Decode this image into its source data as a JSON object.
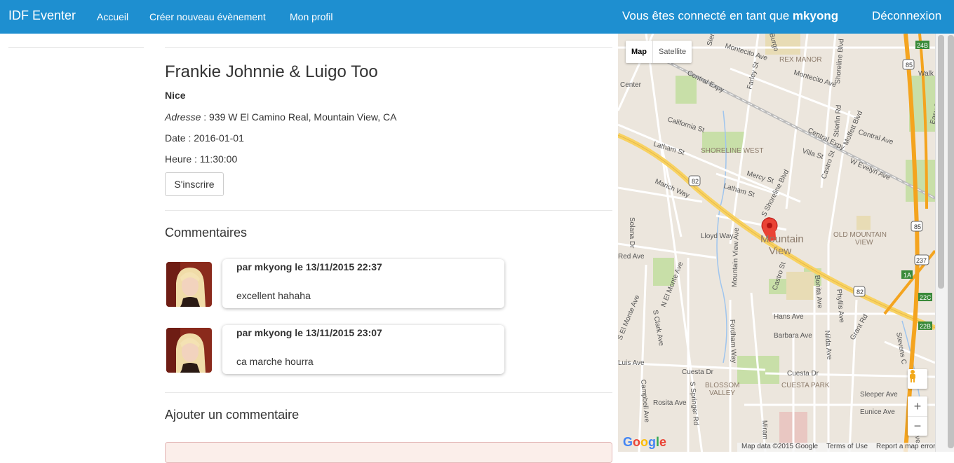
{
  "navbar": {
    "brand": "IDF Eventer",
    "links": [
      "Accueil",
      "Créer nouveau évènement",
      "Mon profil"
    ],
    "connected_text": "Vous êtes connecté en tant que",
    "username": "mkyong",
    "logout": "Déconnexion"
  },
  "event": {
    "title": "Frankie Johnnie & Luigo Too",
    "venue": "Nice",
    "address_label": "Adresse",
    "address": " : 939 W El Camino Real, Mountain View, CA",
    "date": "Date : 2016-01-01",
    "time": "Heure : 11:30:00",
    "register_button": "S'inscrire"
  },
  "comments": {
    "section_title": "Commentaires",
    "items": [
      {
        "author_line": "par mkyong le 13/11/2015 22:37",
        "text": "excellent hahaha"
      },
      {
        "author_line": "par mkyong le 13/11/2015 23:07",
        "text": "ca marche hourra"
      }
    ]
  },
  "add_comment": {
    "section_title": "Ajouter un commentaire"
  },
  "map": {
    "type_map": "Map",
    "type_satellite": "Satellite",
    "zoom_in": "+",
    "zoom_out": "−",
    "attribution": [
      "Map data ©2015 Google",
      "Terms of Use",
      "Report a map error"
    ],
    "google_letters": [
      "G",
      "o",
      "o",
      "g",
      "l",
      "e"
    ],
    "labels": {
      "mountain_view_1": "Mountain",
      "mountain_view_2": "View",
      "rex_manor": "REX MANOR",
      "shoreline_west": "SHORELINE WEST",
      "old_mv_1": "OLD MOUNTAIN",
      "old_mv_2": "VIEW",
      "blossom_1": "BLOSSOM",
      "blossom_2": "VALLEY",
      "cuesta_park": "CUESTA PARK",
      "central_expy": "Central Expy",
      "central_expy2": "Central Expy",
      "california_st": "California St",
      "latham_st": "Latham St",
      "latham_st2": "Latham St",
      "mercy_st": "Mercy St",
      "villa_st": "Villa St",
      "castro_st": "Castro St",
      "castro_st2": "Castro St",
      "evelyn": "W Evelyn Ave",
      "marich": "Marich Way",
      "lloyd": "Lloyd Way",
      "shoreline_blvd": "S Shoreline Blvd",
      "hans": "Hans Ave",
      "barbara": "Barbara Ave",
      "cuesta_dr": "Cuesta Dr",
      "cuesta_dr2": "Cuesta Dr",
      "rosita": "Rosita Ave",
      "sleeper": "Sleeper Ave",
      "eunice": "Eunice Ave",
      "grant": "Grant Rd",
      "montecito": "Montecito Ave",
      "montecito2": "Montecito Ave",
      "farley": "Farley St",
      "sierra": "Sierra Vista",
      "central_ave": "Central Ave",
      "moffett": "Moffett Blvd",
      "stierlin": "Stierlin Rd",
      "shoreline_blvd_n": "Shoreline Blvd",
      "center": "Center",
      "solana": "Solana Dr",
      "red_ave": "Red Ave",
      "el_monte": "N El Monte Ave",
      "s_el_monte": "S El Monte Ave",
      "clark": "S Clark Ave",
      "mv_ave": "Mountain View Ave",
      "fordham": "Fordham Way",
      "springer": "S Springer Rd",
      "campbell": "Campbell Ave",
      "luis": "Luis Ave",
      "bonita": "Bonita Ave",
      "phyllis": "Phyllis Ave",
      "nilda": "Nilda Ave",
      "sun_mor": "Sun Mor Ave",
      "stevens": "Stevens C",
      "easy": "Easy St",
      "walk": "Walk",
      "miram": "Miram",
      "burgo": "Burgo",
      "hwy82a": "82",
      "hwy82b": "82",
      "hwy85a": "85",
      "hwy85b": "85",
      "hwy237": "237",
      "exit24b": "24B",
      "exit1a": "1A",
      "exit22c": "22C",
      "exit22b": "22B"
    }
  }
}
